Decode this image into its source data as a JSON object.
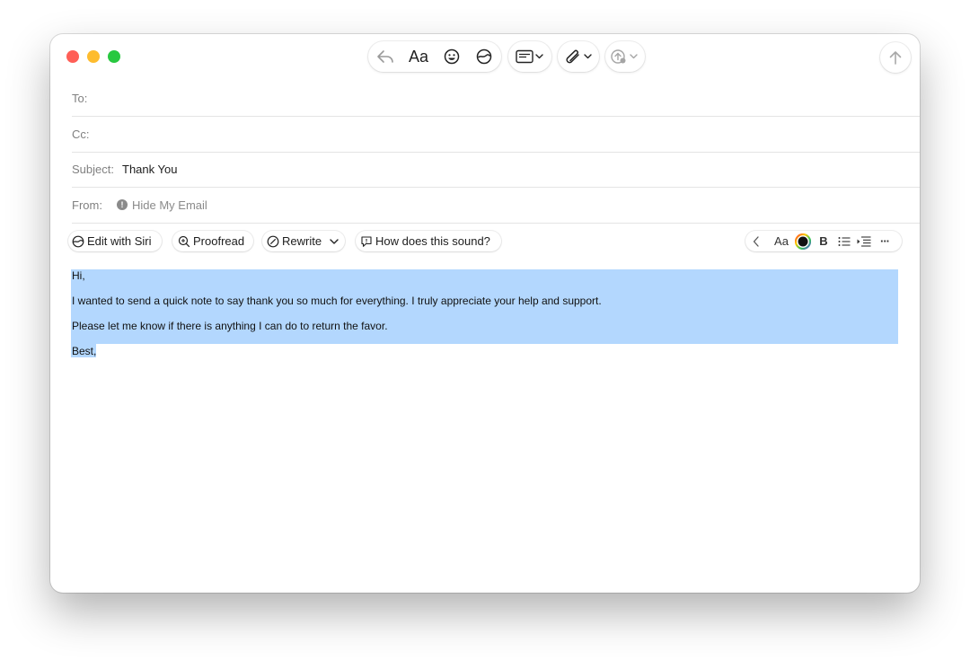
{
  "toolbar": {
    "reply_icon": "reply-arrow-icon",
    "font_label": "Aa",
    "emoji_icon": "smiley-icon",
    "writing_tools_icon": "writing-tools-icon",
    "header_fields_icon": "header-fields-icon",
    "attach_icon": "paperclip-icon",
    "photo_icon": "photo-upload-icon",
    "send_icon": "send-arrow-icon"
  },
  "fields": {
    "to_label": "To:",
    "to_value": "",
    "cc_label": "Cc:",
    "cc_value": "",
    "subject_label": "Subject:",
    "subject_value": "Thank You",
    "from_label": "From:",
    "from_value": "Hide My Email"
  },
  "writing_tools": {
    "edit_with_siri": "Edit with Siri",
    "proofread": "Proofread",
    "rewrite": "Rewrite",
    "how_does_this_sound": "How does this sound?"
  },
  "format_bar": {
    "font_label": "Aa",
    "bold_label": "B",
    "more_label": "···"
  },
  "body": {
    "lines": [
      "Hi,",
      "I wanted to send a quick note to say thank you so much for everything. I truly appreciate your help and support.",
      "Please let me know if there is anything I can do to return the favor.",
      "Best,"
    ]
  },
  "colors": {
    "selection": "#b3d7fe",
    "close": "#ff5f57",
    "minimize": "#febc2e",
    "zoom": "#28c840"
  }
}
